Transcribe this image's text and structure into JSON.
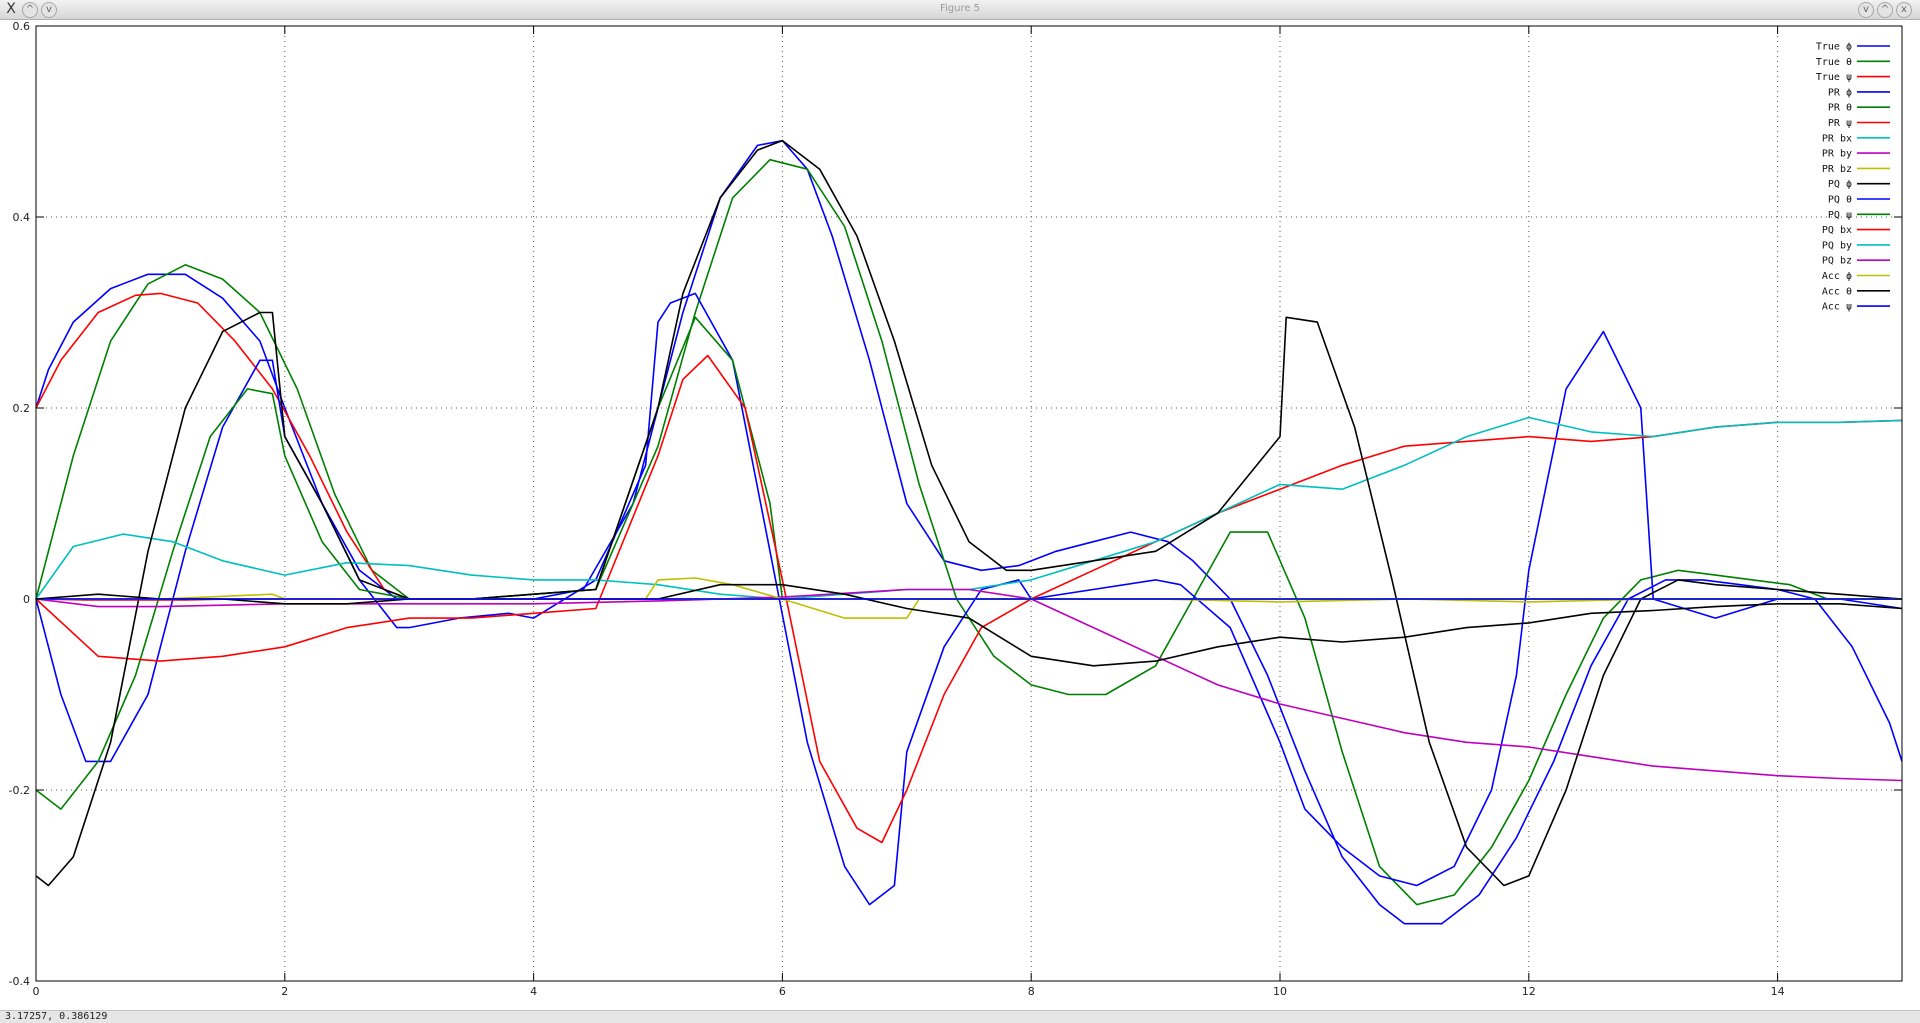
{
  "window": {
    "title": "Figure 5",
    "buttons": [
      "X",
      "^",
      "v"
    ],
    "right_buttons": [
      "v",
      "^",
      "x"
    ]
  },
  "status": {
    "text": "3.17257,  0.386129"
  },
  "chart_data": {
    "type": "line",
    "xlim": [
      0,
      15
    ],
    "ylim": [
      -0.4,
      0.6
    ],
    "xticks": [
      0,
      2,
      4,
      6,
      8,
      10,
      12,
      14
    ],
    "xtick_labels": [
      "0",
      "2",
      "4",
      "6",
      "8",
      "10",
      "12",
      "14"
    ],
    "yticks": [
      -0.4,
      -0.2,
      0,
      0.2,
      0.4,
      0.6
    ],
    "ytick_labels": [
      "-0.4",
      "-0.2",
      "0",
      "0.2",
      "0.4",
      "0.6"
    ],
    "grid": true,
    "legend_position": "top-right",
    "series": [
      {
        "name": "True ϕ",
        "color": "#0000ff",
        "x": [
          0,
          0.1,
          0.3,
          0.6,
          0.9,
          1.2,
          1.5,
          1.8,
          2,
          2.3,
          2.6,
          2.9,
          3.2,
          3.6,
          4,
          4.4,
          4.8,
          5,
          5.2,
          5.5,
          5.8,
          6,
          6.2,
          6.4,
          6.7,
          7,
          7.3,
          7.6,
          7.9,
          8.2,
          8.5,
          8.8,
          9.1,
          9.3,
          9.6,
          9.9,
          10.2,
          10.5,
          10.8,
          11,
          11.3,
          11.6,
          11.9,
          12.2,
          12.5,
          12.8,
          13.1,
          13.4,
          13.7,
          14,
          14.3,
          14.6,
          14.9,
          15
        ],
        "y": [
          0.2,
          0.24,
          0.29,
          0.325,
          0.34,
          0.34,
          0.315,
          0.27,
          0.2,
          0.1,
          0.03,
          0,
          0,
          0,
          0,
          0.01,
          0.1,
          0.2,
          0.3,
          0.42,
          0.475,
          0.48,
          0.45,
          0.38,
          0.25,
          0.1,
          0.04,
          0.03,
          0.035,
          0.05,
          0.06,
          0.07,
          0.06,
          0.04,
          0.0,
          -0.08,
          -0.18,
          -0.27,
          -0.32,
          -0.34,
          -0.34,
          -0.31,
          -0.25,
          -0.17,
          -0.07,
          0.0,
          0.02,
          0.02,
          0.015,
          0.01,
          0.0,
          -0.05,
          -0.13,
          -0.17
        ]
      },
      {
        "name": "True θ",
        "color": "#008000",
        "x": [
          0,
          0.3,
          0.6,
          0.9,
          1.2,
          1.5,
          1.8,
          2.1,
          2.4,
          2.7,
          3,
          3.5,
          4,
          4.5,
          5,
          5.3,
          5.6,
          5.9,
          6.2,
          6.5,
          6.8,
          7.1,
          7.4,
          7.7,
          8,
          8.3,
          8.6,
          9,
          9.3,
          9.6,
          9.9,
          10.2,
          10.5,
          10.8,
          11.1,
          11.4,
          11.7,
          12,
          12.3,
          12.6,
          12.9,
          13.2,
          13.5,
          13.8,
          14.1,
          14.4,
          14.7,
          15
        ],
        "y": [
          0,
          0.15,
          0.27,
          0.33,
          0.35,
          0.335,
          0.3,
          0.22,
          0.11,
          0.03,
          0,
          0,
          0.005,
          0.01,
          0.16,
          0.3,
          0.42,
          0.46,
          0.45,
          0.39,
          0.27,
          0.12,
          0.0,
          -0.06,
          -0.09,
          -0.1,
          -0.1,
          -0.07,
          0.0,
          0.07,
          0.07,
          -0.02,
          -0.16,
          -0.28,
          -0.32,
          -0.31,
          -0.26,
          -0.19,
          -0.1,
          -0.02,
          0.02,
          0.03,
          0.025,
          0.02,
          0.015,
          0.0,
          0.0,
          0.0
        ]
      },
      {
        "name": "True ψ",
        "color": "#ff0000",
        "x": [
          0,
          0.2,
          0.5,
          0.8,
          1.0,
          1.3,
          1.6,
          1.9,
          2.2,
          2.5,
          2.8,
          3.0
        ],
        "y": [
          0.2,
          0.25,
          0.3,
          0.318,
          0.32,
          0.31,
          0.27,
          0.22,
          0.15,
          0.07,
          0.01,
          0.0
        ]
      },
      {
        "name": "PR ϕ",
        "color": "#0000ff",
        "x": [
          0,
          0.2,
          0.4,
          0.6,
          0.9,
          1.2,
          1.5,
          1.8,
          1.9,
          2.0,
          2.3,
          2.6,
          2.9,
          3.0,
          3.4,
          3.8,
          4.0,
          4.5,
          4.9,
          5.0,
          5.1,
          5.3,
          5.6,
          5.9,
          6.2,
          6.5,
          6.7,
          6.9,
          7.0,
          7.3,
          7.6,
          7.9,
          8.0,
          9.0,
          9.2,
          9.6,
          10.0,
          10.2,
          10.5,
          10.8,
          11.1,
          11.4,
          11.7,
          11.9,
          12.0,
          12.3,
          12.6,
          12.9,
          13.0,
          13.5,
          14.0,
          14.5,
          15
        ],
        "y": [
          0.0,
          -0.1,
          -0.17,
          -0.17,
          -0.1,
          0.05,
          0.18,
          0.25,
          0.25,
          0.17,
          0.1,
          0.02,
          -0.03,
          -0.03,
          -0.02,
          -0.015,
          -0.02,
          0.02,
          0.14,
          0.29,
          0.31,
          0.32,
          0.25,
          0.05,
          -0.15,
          -0.28,
          -0.32,
          -0.3,
          -0.16,
          -0.05,
          0.01,
          0.02,
          0.0,
          0.02,
          0.015,
          -0.03,
          -0.15,
          -0.22,
          -0.26,
          -0.29,
          -0.3,
          -0.28,
          -0.2,
          -0.08,
          0.03,
          0.22,
          0.28,
          0.2,
          0.0,
          -0.02,
          0.0,
          0.0,
          -0.01
        ]
      },
      {
        "name": "PR θ",
        "color": "#008000",
        "x": [
          0,
          0.2,
          0.5,
          0.8,
          1.1,
          1.4,
          1.7,
          1.9,
          2.0,
          2.3,
          2.6,
          3.0,
          3.5,
          4.0,
          4.5,
          5.0,
          5.3,
          5.6,
          5.9,
          6.0
        ],
        "y": [
          -0.2,
          -0.22,
          -0.17,
          -0.08,
          0.05,
          0.17,
          0.22,
          0.215,
          0.15,
          0.06,
          0.01,
          0.0,
          0.0,
          0.005,
          0.01,
          0.2,
          0.295,
          0.25,
          0.1,
          0.0
        ]
      },
      {
        "name": "PR ψ",
        "color": "#ff0000",
        "x": [
          0,
          0.5,
          1.0,
          1.5,
          2.0,
          2.5,
          3.0,
          3.5,
          4.0,
          4.5,
          5.0,
          5.2,
          5.4,
          5.7,
          6.0,
          6.3,
          6.6,
          6.8,
          7.0,
          7.3,
          7.6,
          8.0,
          8.5,
          9.0,
          9.5,
          10.0,
          10.5,
          11.0,
          11.5,
          12.0,
          12.5,
          13.0,
          13.5,
          14.0,
          14.5,
          15.0
        ],
        "y": [
          0.0,
          -0.06,
          -0.065,
          -0.06,
          -0.05,
          -0.03,
          -0.02,
          -0.02,
          -0.015,
          -0.01,
          0.15,
          0.23,
          0.255,
          0.2,
          0.02,
          -0.17,
          -0.24,
          -0.255,
          -0.2,
          -0.1,
          -0.03,
          0.0,
          0.03,
          0.06,
          0.09,
          0.115,
          0.14,
          0.16,
          0.165,
          0.17,
          0.165,
          0.17,
          0.18,
          0.185,
          0.185,
          0.187
        ]
      },
      {
        "name": "PR bx",
        "color": "#00bfbf",
        "x": [
          0,
          0.3,
          0.7,
          1.1,
          1.5,
          2.0,
          2.5,
          3.0,
          3.5,
          4.0,
          4.5,
          5.0,
          5.5,
          6.0,
          6.5,
          7.0,
          7.5,
          8.0,
          8.5,
          9.0,
          9.5,
          10.0,
          10.5,
          11.0,
          11.5,
          12.0,
          12.5,
          13.0,
          13.5,
          14.0,
          14.5,
          15.0
        ],
        "y": [
          0.0,
          0.055,
          0.068,
          0.06,
          0.04,
          0.025,
          0.038,
          0.035,
          0.025,
          0.02,
          0.02,
          0.015,
          0.005,
          0.0,
          0.005,
          0.01,
          0.01,
          0.02,
          0.04,
          0.06,
          0.09,
          0.12,
          0.115,
          0.14,
          0.17,
          0.19,
          0.175,
          0.17,
          0.18,
          0.185,
          0.185,
          0.187
        ]
      },
      {
        "name": "PR by",
        "color": "#bf00bf",
        "x": [
          0,
          0.5,
          1.0,
          2.0,
          3.0,
          4.0,
          5.0,
          6.0,
          7.0,
          7.5,
          8.0,
          8.5,
          9.0,
          9.5,
          10.0,
          10.5,
          11.0,
          11.5,
          12.0,
          12.5,
          13.0,
          13.5,
          14.0,
          14.5,
          15.0
        ],
        "y": [
          0.0,
          -0.008,
          -0.008,
          -0.005,
          -0.005,
          -0.005,
          -0.002,
          0.002,
          0.01,
          0.01,
          0.0,
          -0.03,
          -0.06,
          -0.09,
          -0.11,
          -0.125,
          -0.14,
          -0.15,
          -0.155,
          -0.165,
          -0.175,
          -0.18,
          -0.185,
          -0.188,
          -0.19
        ]
      },
      {
        "name": "PR bz",
        "color": "#bfbf00",
        "x": [
          0,
          1.0,
          1.9,
          2.0,
          3.0,
          4.0,
          4.9,
          5.0,
          5.3,
          5.6,
          6.0,
          6.5,
          7.0,
          7.1,
          8.0,
          9.0,
          10.0,
          11.0,
          12.0,
          13.0,
          14.0,
          15.0
        ],
        "y": [
          0.0,
          0.0,
          0.005,
          0.0,
          0.0,
          0.0,
          0.0,
          0.02,
          0.022,
          0.015,
          0.0,
          -0.02,
          -0.02,
          0.0,
          0.0,
          0.0,
          -0.003,
          0.0,
          -0.003,
          0.0,
          0.0,
          0.0
        ]
      },
      {
        "name": "PQ ϕ",
        "color": "#000000",
        "x": [
          0,
          0.1,
          0.3,
          0.6,
          0.9,
          1.2,
          1.5,
          1.8,
          1.9,
          2.0,
          2.3,
          2.6,
          3.0,
          3.5,
          4.0,
          4.5,
          5.0,
          5.2,
          5.5,
          5.8,
          6.0,
          6.3,
          6.6,
          6.9,
          7.2,
          7.5,
          7.8,
          8.0,
          8.5,
          9.0,
          9.5,
          10.0,
          10.05,
          10.3,
          10.6,
          10.9,
          11.2,
          11.5,
          11.8,
          12.0,
          12.3,
          12.6,
          12.9,
          13.2,
          13.5,
          14.0,
          14.5,
          15.0
        ],
        "y": [
          -0.29,
          -0.3,
          -0.27,
          -0.15,
          0.05,
          0.2,
          0.28,
          0.3,
          0.3,
          0.17,
          0.1,
          0.02,
          0.0,
          0.0,
          0.005,
          0.01,
          0.2,
          0.32,
          0.42,
          0.47,
          0.48,
          0.45,
          0.38,
          0.27,
          0.14,
          0.06,
          0.03,
          0.03,
          0.04,
          0.05,
          0.09,
          0.17,
          0.295,
          0.29,
          0.18,
          0.02,
          -0.15,
          -0.26,
          -0.3,
          -0.29,
          -0.2,
          -0.08,
          0.0,
          0.02,
          0.015,
          0.01,
          0.005,
          0.0
        ]
      },
      {
        "name": "PQ θ",
        "color": "#0000ff",
        "x": [
          0,
          1,
          2,
          3,
          4,
          5,
          6,
          7,
          8,
          9,
          10,
          11,
          12,
          13,
          14,
          15
        ],
        "y": [
          0,
          0,
          0,
          0,
          0,
          0,
          0,
          0,
          0,
          0,
          0,
          0,
          0,
          0,
          0,
          0
        ]
      },
      {
        "name": "PQ ψ",
        "color": "#008000",
        "x": [
          0,
          0.5,
          1.0,
          1.5,
          2.0,
          2.5,
          3.0,
          3.5,
          4.0,
          4.5,
          5.0,
          5.5,
          6.0,
          6.5,
          7.0,
          7.5,
          8.0,
          8.5,
          9.0,
          9.5,
          10.0,
          10.5,
          11.0,
          11.5,
          12.0,
          12.5,
          13.0,
          13.5,
          14.0,
          14.5,
          15.0
        ],
        "y": [
          0,
          0,
          0,
          0,
          0,
          0,
          0,
          0,
          0,
          0,
          0,
          0,
          0,
          0,
          0,
          0,
          0,
          0,
          0,
          0,
          0,
          0,
          0,
          0,
          0,
          0,
          0,
          0,
          0,
          0,
          0
        ]
      },
      {
        "name": "PQ bx",
        "color": "#ff0000",
        "x": [
          0,
          0.4,
          0.8,
          1.2,
          1.6,
          2.0,
          2.5,
          3.0
        ],
        "y": [
          0,
          -0.001,
          -0.001,
          -0.001,
          0,
          0,
          0,
          0
        ]
      },
      {
        "name": "PQ by",
        "color": "#00bfbf",
        "x": [
          0,
          1,
          2,
          3,
          4,
          5,
          5.5
        ],
        "y": [
          0,
          0,
          0,
          0,
          0,
          0,
          0
        ]
      },
      {
        "name": "PQ bz",
        "color": "#bf00bf",
        "x": [
          0,
          1,
          2,
          3,
          4,
          5,
          6
        ],
        "y": [
          0,
          0,
          0,
          0,
          0,
          0,
          0
        ]
      },
      {
        "name": "Acc ϕ",
        "color": "#bfbf00",
        "x": [
          0,
          1,
          2,
          3,
          4,
          5,
          6,
          7,
          8,
          9,
          10,
          11,
          12,
          13,
          14,
          15
        ],
        "y": [
          0,
          0,
          0,
          0,
          0,
          0,
          0,
          0,
          0,
          0,
          0,
          0,
          0,
          0,
          0,
          0
        ]
      },
      {
        "name": "Acc θ",
        "color": "#000000",
        "x": [
          0,
          0.5,
          1.0,
          1.5,
          2.0,
          2.5,
          3.0,
          3.5,
          4.0,
          4.5,
          5.0,
          5.5,
          6.0,
          6.5,
          7.0,
          7.5,
          8.0,
          8.5,
          9.0,
          9.5,
          10.0,
          10.5,
          11.0,
          11.5,
          12.0,
          12.5,
          13.0,
          13.5,
          14.0,
          14.5,
          15.0
        ],
        "y": [
          0.0,
          0.005,
          0.0,
          0.0,
          -0.005,
          -0.005,
          0.0,
          0.0,
          0.0,
          0.0,
          0.0,
          0.015,
          0.015,
          0.005,
          -0.01,
          -0.02,
          -0.06,
          -0.07,
          -0.065,
          -0.05,
          -0.04,
          -0.045,
          -0.04,
          -0.03,
          -0.025,
          -0.015,
          -0.012,
          -0.008,
          -0.005,
          -0.005,
          -0.01
        ]
      },
      {
        "name": "Acc ψ",
        "color": "#0000ff",
        "x": [
          0,
          1,
          2,
          3,
          4,
          5,
          6,
          7,
          8,
          9,
          10,
          11,
          12,
          13,
          14,
          15
        ],
        "y": [
          0,
          0,
          0,
          0,
          0,
          0,
          0,
          0,
          0,
          0,
          0,
          0,
          0,
          0,
          0,
          0
        ]
      }
    ]
  }
}
